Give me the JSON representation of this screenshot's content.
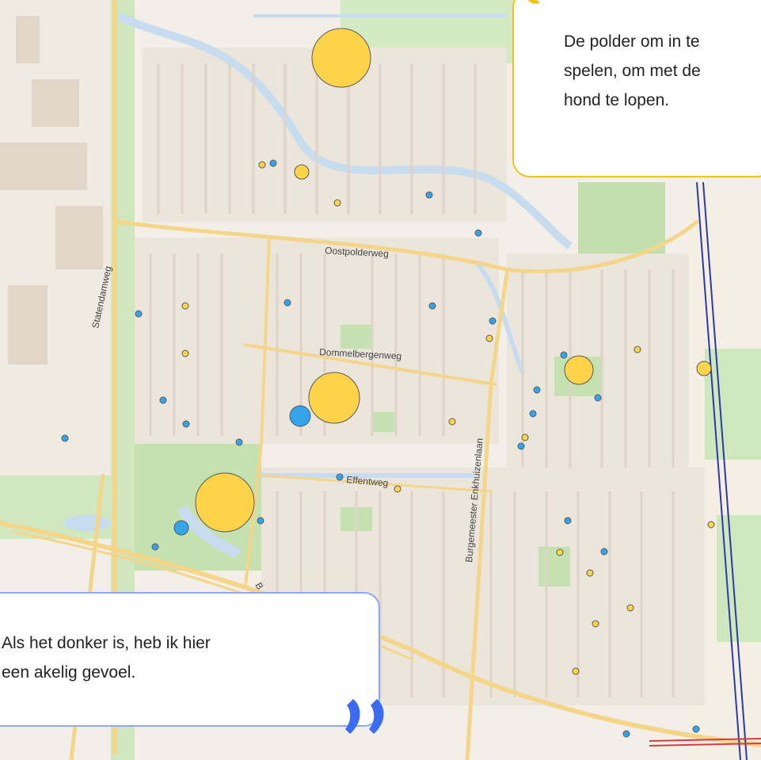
{
  "map": {
    "road_labels": {
      "oostpolderweg": "Oostpolderweg",
      "statendamweg": "Statendamweg",
      "dommelbergenweg": "Dommelbergenweg",
      "effentweg": "Effentweg",
      "enkhuizenlaan": "Burgemeester Enkhuizenlaan"
    },
    "colors": {
      "yellow_marker": "#fdd34a",
      "blue_marker": "#33a4ec",
      "land": "#f4f1ec",
      "buildings": "#e9e2d8",
      "green": "#bcdcaa",
      "water": "#c9dcf0",
      "road": "#f6d98c"
    }
  },
  "callouts": {
    "yellow": {
      "text": "De polder om in te\nspelen, om met de\nhond te lopen.",
      "color": "#f2c21b"
    },
    "blue": {
      "text": "Als het donker is, heb ik hier\neen akelig gevoel.",
      "color": "#3b6cf0"
    }
  },
  "markers": [
    {
      "type": "yellow",
      "size": "large"
    },
    {
      "type": "yellow",
      "size": "large"
    },
    {
      "type": "yellow",
      "size": "large"
    },
    {
      "type": "yellow",
      "size": "medium"
    },
    {
      "type": "blue",
      "size": "medium"
    },
    {
      "type": "blue",
      "size": "medium"
    }
  ]
}
